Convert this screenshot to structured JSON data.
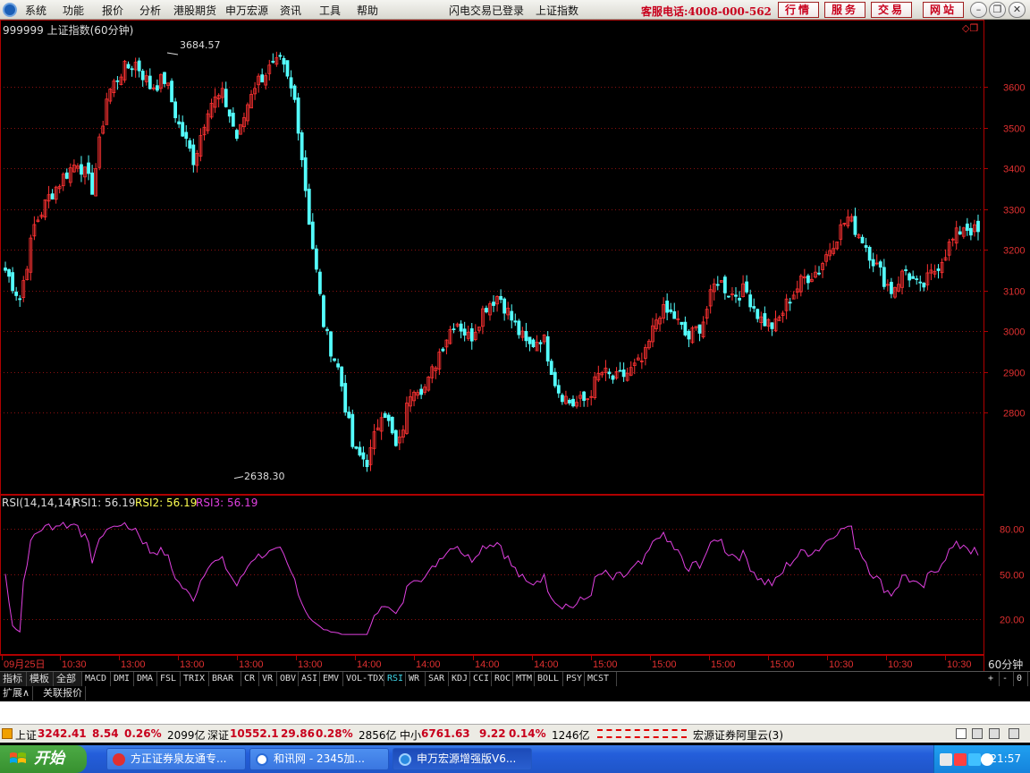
{
  "menubar": {
    "items": [
      "系统",
      "功能",
      "报价",
      "分析",
      "港股期货",
      "申万宏源",
      "资讯",
      "工具",
      "帮助"
    ],
    "login_status": "闪电交易已登录",
    "current_index": "上证指数",
    "hotline": "客服电话:4008-000-562",
    "nav_buttons": [
      "行情",
      "服务",
      "交易",
      "网站"
    ]
  },
  "chart": {
    "header": "999999 上证指数(60分钟)",
    "high_label": "3684.57",
    "low_label": "2638.30",
    "price_axis": [
      "3600",
      "3500",
      "3400",
      "3300",
      "3200",
      "3100",
      "3000",
      "2900",
      "2800"
    ],
    "rsi_header": {
      "name": "RSI(14,14,14)",
      "rsi1": "RSI1: 56.19",
      "rsi2": "RSI2: 56.19",
      "rsi3": "RSI3: 56.19"
    },
    "rsi_axis": [
      "80.00",
      "50.00",
      "20.00"
    ],
    "time_axis": [
      "09月25日",
      "10:30",
      "13:00",
      "13:00",
      "13:00",
      "13:00",
      "14:00",
      "14:00",
      "14:00",
      "14:00",
      "15:00",
      "15:00",
      "15:00",
      "15:00",
      "10:30",
      "10:30",
      "10:30"
    ],
    "period": "60分钟",
    "colors": {
      "up": "#ff3232",
      "down": "#54ffff",
      "rsi": "#e040e0",
      "grid": "#8a1010",
      "axis": "#b00000"
    }
  },
  "chart_data": {
    "type": "candlestick",
    "title": "999999 上证指数(60分钟)",
    "price_range": [
      2600,
      3700
    ],
    "extremes": {
      "high": 3684.57,
      "low": 2638.3
    },
    "approx_close_path": [
      3150,
      3080,
      3260,
      3330,
      3380,
      3420,
      3350,
      3580,
      3640,
      3660,
      3600,
      3620,
      3500,
      3420,
      3560,
      3580,
      3470,
      3600,
      3640,
      3660,
      3560,
      3250,
      3000,
      2900,
      2700,
      2680,
      2820,
      2700,
      2870,
      2860,
      2960,
      3030,
      2980,
      3060,
      3090,
      3020,
      2960,
      2990,
      2860,
      2820,
      2830,
      2900,
      2880,
      2900,
      2930,
      3050,
      3040,
      2980,
      3020,
      3130,
      3090,
      3100,
      3030,
      3010,
      3080,
      3130,
      3150,
      3220,
      3280,
      3230,
      3160,
      3100,
      3150,
      3100,
      3150,
      3210,
      3260,
      3240
    ],
    "rsi": {
      "params": [
        14,
        14,
        14
      ],
      "last": 56.19,
      "range": [
        0,
        100
      ]
    }
  },
  "indicator_tabs": [
    "指标",
    "模板",
    "全部",
    "MACD",
    "DMI",
    "DMA",
    "FSL",
    "TRIX",
    "BRAR",
    "CR",
    "VR",
    "OBV",
    "ASI",
    "EMV",
    "VOL-TDX",
    "RSI",
    "WR",
    "SAR",
    "KDJ",
    "CCI",
    "ROC",
    "MTM",
    "BOLL",
    "PSY",
    "MCST"
  ],
  "active_indicator": "RSI",
  "pager": [
    "+",
    "-",
    "0"
  ],
  "expand_row": [
    "扩展∧",
    "关联报价"
  ],
  "quote_bar": {
    "sh_name": "上证",
    "sh_price": "3242.41",
    "sh_chg": "8.54",
    "sh_pct": "0.26%",
    "sh_amt": "2099亿",
    "sz_name": "深证",
    "sz_price": "10552.1",
    "sz_chg": "29.86",
    "sz_pct": "0.28%",
    "sz_amt": "2856亿",
    "zx_name": "中小",
    "zx_price": "6761.63",
    "zx_chg": "9.22",
    "zx_pct": "0.14%",
    "zx_amt": "1246亿",
    "broker": "宏源证券阿里云(3)"
  },
  "taskbar": {
    "start": "开始",
    "tasks": [
      "方正证券泉友通专...",
      "和讯网 - 2345加...",
      "申万宏源增强版V6..."
    ],
    "clock": "21:57"
  }
}
